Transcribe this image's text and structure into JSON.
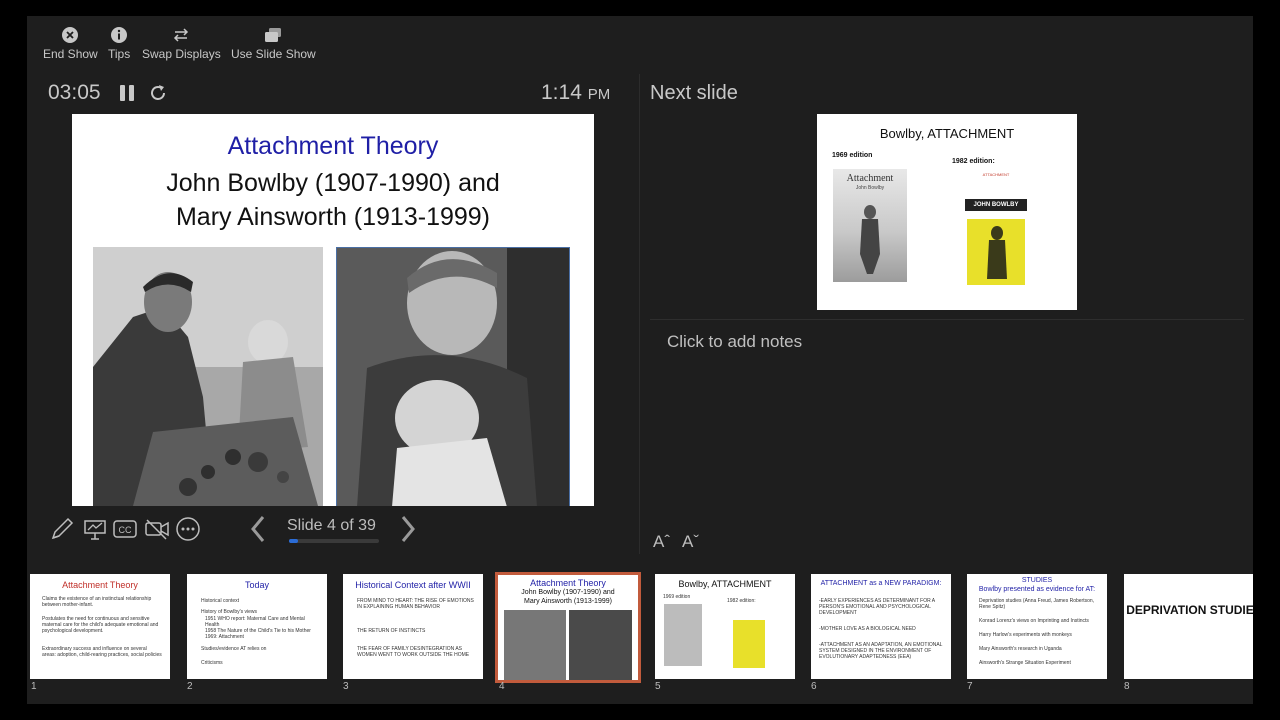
{
  "toolbar": {
    "end_show": "End Show",
    "tips": "Tips",
    "swap_displays": "Swap Displays",
    "use_slide_show": "Use Slide Show"
  },
  "timer": "03:05",
  "clock": {
    "time": "1:14",
    "ampm": "PM"
  },
  "current_slide": {
    "title": "Attachment Theory",
    "line1": "John Bowlby (1907-1990) and",
    "line2": "Mary Ainsworth (1913-1999)"
  },
  "counter": "Slide 4 of 39",
  "progress_fraction": 0.1026,
  "next": {
    "label": "Next slide",
    "title": "Bowlby, ATTACHMENT",
    "ed1969": "1969 edition",
    "ed1982": "1982 edition:",
    "book1_title": "Attachment",
    "book1_author": "John Bowlby",
    "book2_author": "JOHN BOWLBY",
    "book2_title": "ATTACHMENT"
  },
  "notes_placeholder": "Click to add notes",
  "font_increase": "Aˆ",
  "font_decrease": "Aˇ",
  "thumbnails": [
    {
      "num": "1",
      "title": "Attachment Theory",
      "title_color": "#c0302a",
      "lines": [
        "Claims the existence of an instinctual relationship between mother-infant.",
        "Postulates the need for continuous and sensitive maternal care for the child's adequate emotional and psychological development.",
        "Extraordinary success and influence on several areas: adoption, child-rearing practices, social policies"
      ]
    },
    {
      "num": "2",
      "title": "Today",
      "title_color": "#1f1fa6",
      "lines": [
        "Historical context",
        "History of Bowlby's views",
        "1951 WHO report: Maternal Care and Mental Health",
        "1958 The Nature of the Child's Tie to his Mother",
        "1969: Attachment",
        "Studies/evidence AT relies on",
        "Criticisms"
      ]
    },
    {
      "num": "3",
      "title": "Historical Context after WWII",
      "title_color": "#1f1fa6",
      "lines": [
        "FROM MIND TO HEART: THE RISE OF EMOTIONS IN EXPLAINING HUMAN BEHAVIOR",
        "THE RETURN OF INSTINCTS",
        "THE FEAR OF FAMILY DESINTEGRATION AS WOMEN WENT TO WORK OUTSIDE THE HOME"
      ]
    },
    {
      "num": "4",
      "title": "Attachment Theory",
      "title_color": "#1f1fa6",
      "lines": [
        "John Bowlby (1907-1990) and",
        "Mary Ainsworth (1913-1999)"
      ]
    },
    {
      "num": "5",
      "title": "Bowlby, ATTACHMENT",
      "title_color": "#111111",
      "lines": [
        "1969 edition",
        "1982 edition:"
      ]
    },
    {
      "num": "6",
      "title": "ATTACHMENT as a NEW PARADIGM:",
      "title_color": "#1f1fa6",
      "lines": [
        "-EARLY EXPERIENCES AS DETERMINANT FOR A PERSON'S EMOTIONAL AND PSYCHOLOGICAL DEVELOPMENT",
        "-MOTHER LOVE AS A BIOLOGICAL NEED",
        "-ATTACHMENT AS AN ADAPTATION, AN EMOTIONAL SYSTEM DESIGNED IN THE ENVIRONMENT OF EVOLUTIONARY ADAPTEDNESS (EEA)"
      ]
    },
    {
      "num": "7",
      "title": "STUDIES",
      "title_color": "#1f1fa6",
      "subtitle": "Bowlby presented as evidence for AT:",
      "lines": [
        "Deprivation studies (Anna Freud, James Robertson, Rene Spitz)",
        "Konrad Lorenz's views on Imprinting and Instincts",
        "Harry Harlow's experiments with monkeys",
        "Mary Ainsworth's research in Uganda",
        "Ainsworth's Strange Situation Experiment"
      ]
    },
    {
      "num": "8",
      "title": "DEPRIVATION STUDIES",
      "title_color": "#111111",
      "lines": []
    }
  ],
  "colors": {
    "accent": "#2b6cd6",
    "selected_outline": "#c25b3c",
    "background": "#1e1e1e"
  }
}
